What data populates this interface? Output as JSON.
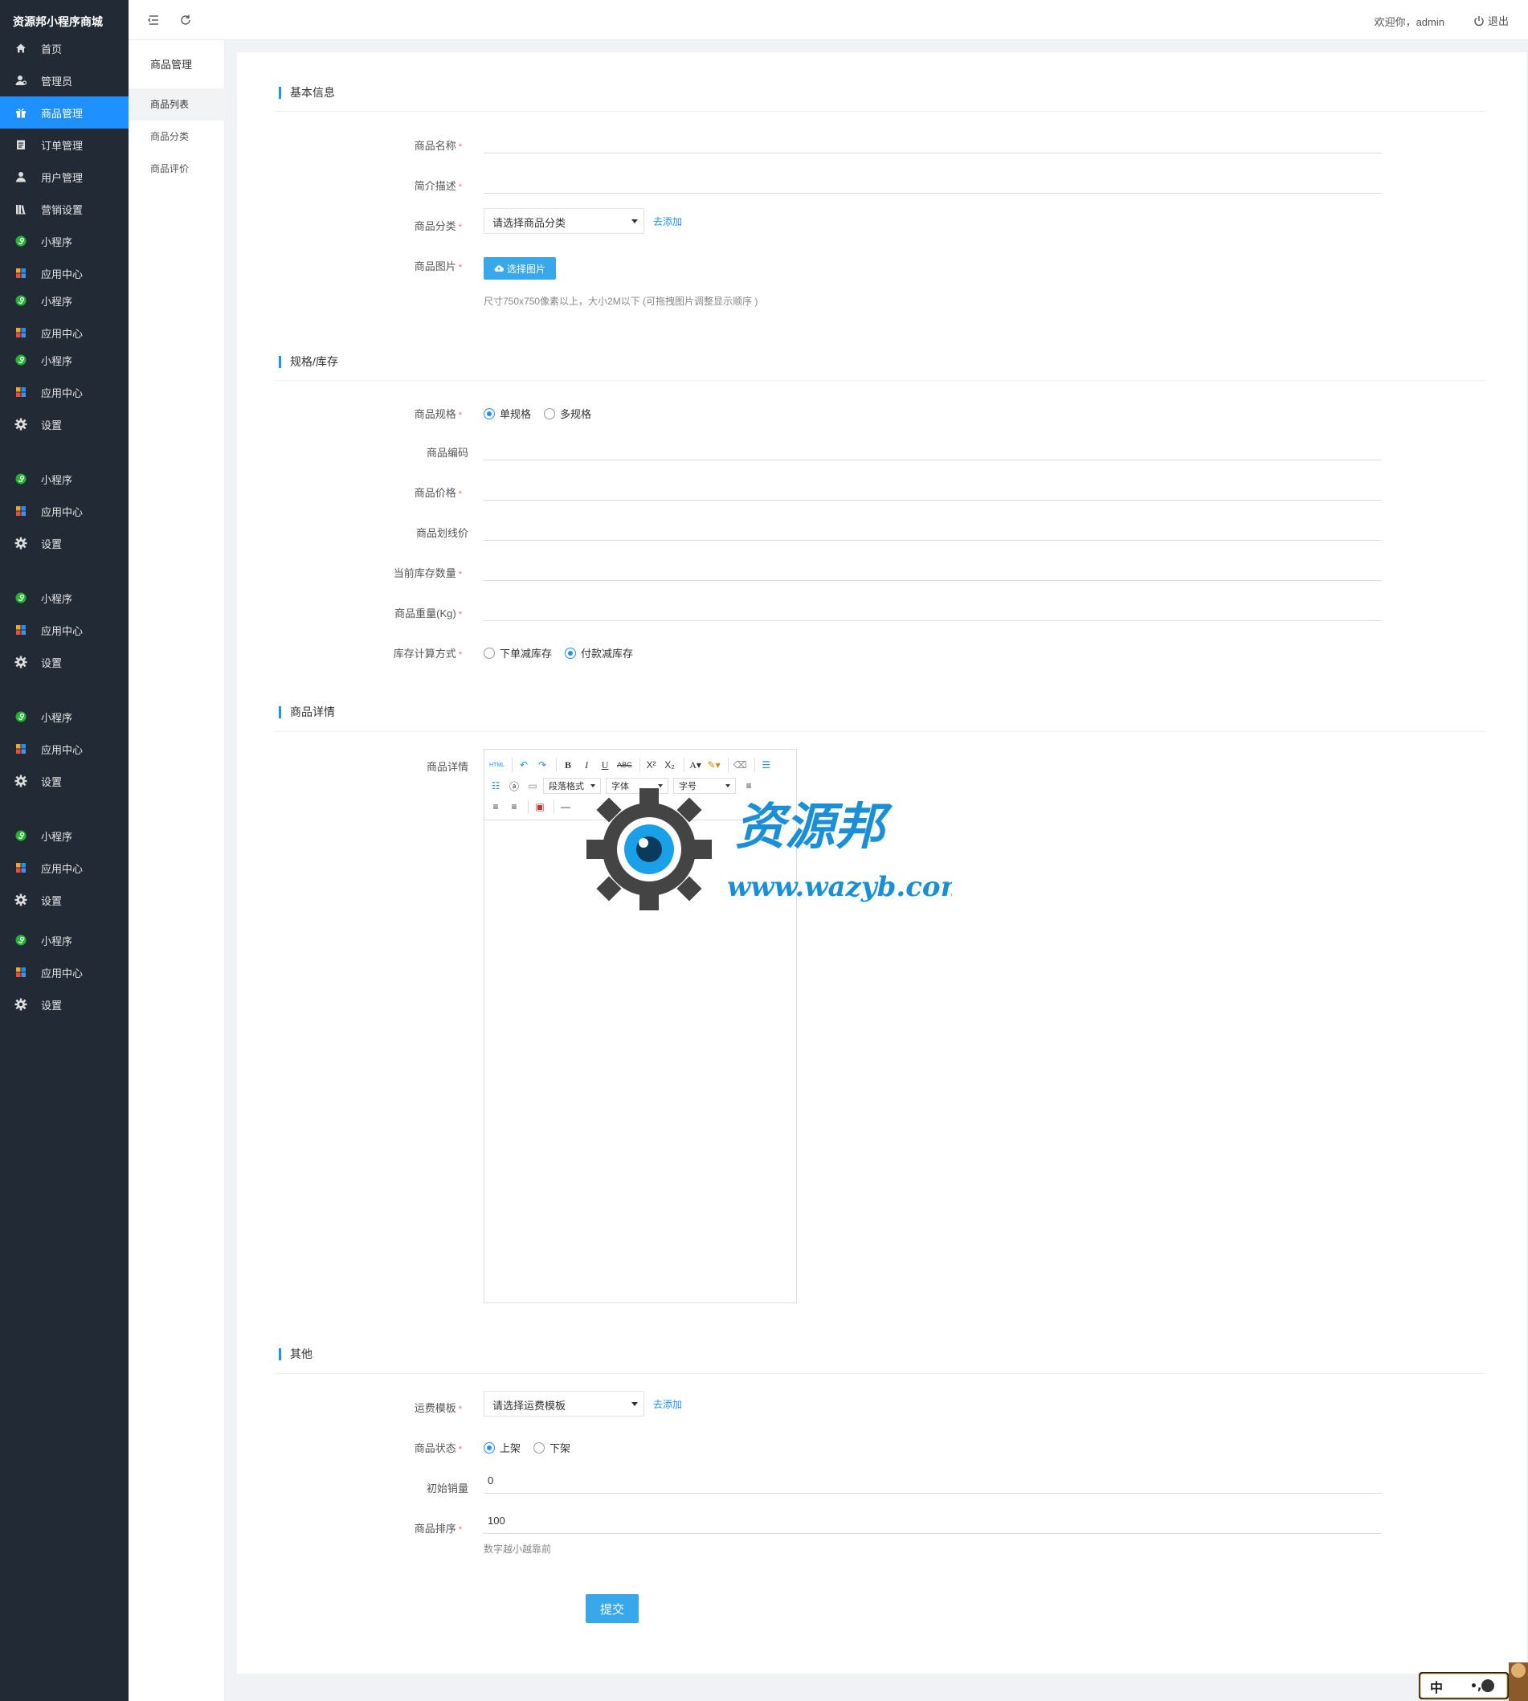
{
  "app": {
    "brand": "资源邦小程序商城"
  },
  "sidebar": {
    "items": [
      {
        "label": "首页",
        "icon": "home-icon"
      },
      {
        "label": "管理员",
        "icon": "admin-icon"
      },
      {
        "label": "商品管理",
        "icon": "gift-icon",
        "active": true
      },
      {
        "label": "订单管理",
        "icon": "order-icon"
      },
      {
        "label": "用户管理",
        "icon": "user-icon"
      },
      {
        "label": "营销设置",
        "icon": "marketing-icon"
      },
      {
        "label": "小程序",
        "icon": "miniapp-icon"
      },
      {
        "label": "应用中心",
        "icon": "apps-icon"
      },
      {
        "label": "小程序",
        "icon": "miniapp-icon"
      },
      {
        "label": "应用中心",
        "icon": "apps-icon"
      },
      {
        "label": "小程序",
        "icon": "miniapp-icon"
      },
      {
        "label": "应用中心",
        "icon": "apps-icon"
      },
      {
        "label": "设置",
        "icon": "gear-icon"
      },
      {
        "label": "小程序",
        "icon": "miniapp-icon"
      },
      {
        "label": "应用中心",
        "icon": "apps-icon"
      },
      {
        "label": "设置",
        "icon": "gear-icon"
      },
      {
        "label": "小程序",
        "icon": "miniapp-icon"
      },
      {
        "label": "应用中心",
        "icon": "apps-icon"
      },
      {
        "label": "设置",
        "icon": "gear-icon"
      },
      {
        "label": "小程序",
        "icon": "miniapp-icon"
      },
      {
        "label": "应用中心",
        "icon": "apps-icon"
      },
      {
        "label": "设置",
        "icon": "gear-icon"
      },
      {
        "label": "小程序",
        "icon": "miniapp-icon"
      },
      {
        "label": "应用中心",
        "icon": "apps-icon"
      },
      {
        "label": "设置",
        "icon": "gear-icon"
      },
      {
        "label": "小程序",
        "icon": "miniapp-icon"
      },
      {
        "label": "应用中心",
        "icon": "apps-icon"
      },
      {
        "label": "设置",
        "icon": "gear-icon"
      }
    ]
  },
  "subnav": {
    "title": "商品管理",
    "items": [
      {
        "label": "商品列表",
        "active": true
      },
      {
        "label": "商品分类"
      },
      {
        "label": "商品评价"
      }
    ]
  },
  "topbar": {
    "welcome": "欢迎你，admin",
    "logout": "退出"
  },
  "sections": {
    "basic": "基本信息",
    "spec": "规格/库存",
    "detail": "商品详情",
    "other": "其他"
  },
  "form": {
    "name_label": "商品名称",
    "desc_label": "简介描述",
    "category_label": "商品分类",
    "category_placeholder": "请选择商品分类",
    "add_link": "去添加",
    "image_label": "商品图片",
    "image_button": "选择图片",
    "image_hint": "尺寸750x750像素以上，大小2M以下 (可拖拽图片调整显示顺序 )",
    "spec_label": "商品规格",
    "spec_single": "单规格",
    "spec_multi": "多规格",
    "code_label": "商品编码",
    "price_label": "商品价格",
    "lineprice_label": "商品划线价",
    "stock_label": "当前库存数量",
    "weight_label": "商品重量(Kg)",
    "stockcalc_label": "库存计算方式",
    "stockcalc_order": "下单减库存",
    "stockcalc_pay": "付款减库存",
    "detail_label": "商品详情",
    "shipping_label": "运费模板",
    "shipping_placeholder": "请选择运费模板",
    "status_label": "商品状态",
    "status_on": "上架",
    "status_off": "下架",
    "initsales_label": "初始销量",
    "initsales_value": "0",
    "sort_label": "商品排序",
    "sort_value": "100",
    "sort_hint": "数字越小越靠前",
    "submit": "提交"
  },
  "editor": {
    "html": "HTML",
    "paragraph": "段落格式",
    "font": "字体",
    "size": "字号"
  },
  "watermark": {
    "title": "资源邦",
    "url": "www.wazyb.com"
  },
  "ime": {
    "label": "中"
  },
  "colors": {
    "sidebar": "#222a36",
    "accent": "#1e90ff",
    "button": "#38a8ea"
  }
}
